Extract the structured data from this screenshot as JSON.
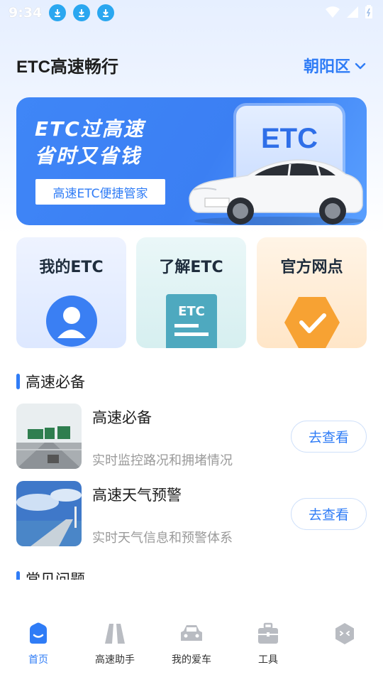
{
  "status_bar": {
    "time": "9:34",
    "download_icons": [
      "download-icon",
      "download-icon",
      "download-icon"
    ],
    "right_icons": [
      "wifi-icon",
      "signal-icon",
      "battery-icon"
    ]
  },
  "header": {
    "app_title": "ETC高速畅行",
    "district": "朝阳区"
  },
  "banner": {
    "line1": "ETC过高速",
    "line2": "省时又省钱",
    "tag": "高速ETC便捷管家",
    "card_text": "ETC"
  },
  "features": [
    {
      "label": "我的ETC",
      "icon": "user-icon"
    },
    {
      "label": "了解ETC",
      "icon": "etc-card-icon"
    },
    {
      "label": "官方网点",
      "icon": "check-badge-icon"
    }
  ],
  "section1": {
    "title": "高速必备"
  },
  "list": [
    {
      "title": "高速必备",
      "desc": "实时监控路况和拥堵情况",
      "button": "去查看"
    },
    {
      "title": "高速天气预警",
      "desc": "实时天气信息和预警体系",
      "button": "去查看"
    }
  ],
  "section2": {
    "title": "常见问题"
  },
  "bottom_nav": [
    {
      "label": "首页",
      "icon": "home-icon",
      "active": true
    },
    {
      "label": "高速助手",
      "icon": "road-icon",
      "active": false
    },
    {
      "label": "我的爱车",
      "icon": "car-icon",
      "active": false
    },
    {
      "label": "工具",
      "icon": "toolbox-icon",
      "active": false
    },
    {
      "label": "",
      "icon": "hexagon-face-icon",
      "active": false
    }
  ],
  "colors": {
    "accent": "#2f7cf6",
    "banner": "#3b7ff3",
    "download_badge": "#2aa7f0"
  }
}
